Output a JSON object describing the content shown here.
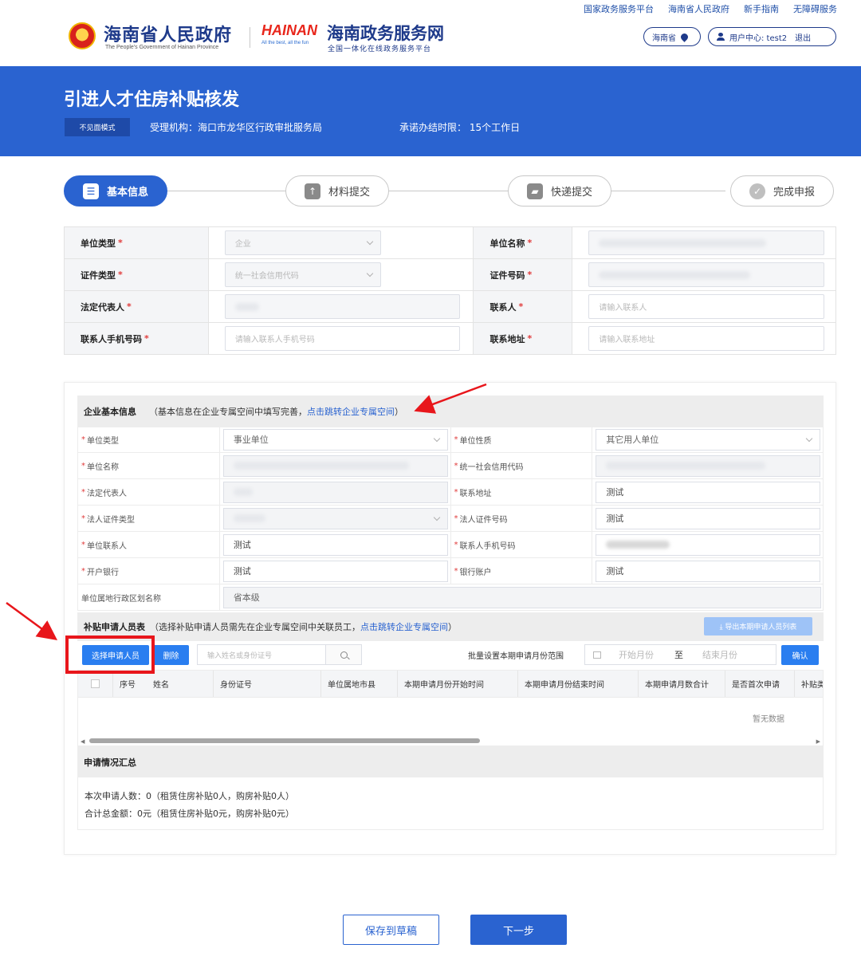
{
  "top_links": [
    "国家政务服务平台",
    "海南省人民政府",
    "新手指南",
    "无障碍服务"
  ],
  "header": {
    "gov_title": "海南省人民政府",
    "gov_subtitle": "The People's Government of Hainan Province",
    "hainan_logo": "HAINAN",
    "service_title": "海南政务服务网",
    "service_subtitle": "全国一体化在线政务服务平台",
    "region": "海南省",
    "user_center": "用户中心: test2",
    "logout": "退出"
  },
  "banner": {
    "title": "引进人才住房补贴核发",
    "mode_button": "不见面模式",
    "agency": "受理机构：海口市龙华区行政审批服务局",
    "deadline": "承诺办结时限： 15个工作日"
  },
  "steps": [
    {
      "label": "基本信息",
      "icon": "document-icon",
      "active": true
    },
    {
      "label": "材料提交",
      "icon": "upload-icon",
      "active": false
    },
    {
      "label": "快递提交",
      "icon": "truck-icon",
      "active": false
    },
    {
      "label": "完成申报",
      "icon": "check-circle-icon",
      "active": false
    }
  ],
  "basic_form": {
    "unit_type_label": "单位类型",
    "unit_type_value": "企业",
    "unit_name_label": "单位名称",
    "cert_type_label": "证件类型",
    "cert_type_value": "统一社会信用代码",
    "cert_no_label": "证件号码",
    "legal_rep_label": "法定代表人",
    "contact_label": "联系人",
    "contact_placeholder": "请输入联系人",
    "contact_phone_label": "联系人手机号码",
    "contact_phone_placeholder": "请输入联系人手机号码",
    "contact_addr_label": "联系地址",
    "contact_addr_placeholder": "请输入联系地址",
    "required_mark": "*"
  },
  "enterprise": {
    "section_title": "企业基本信息",
    "note_prefix": "（基本信息在企业专属空间中填写完善，",
    "note_link": "点击跳转企业专属空间",
    "note_suffix": "）",
    "star": "*",
    "rows": [
      {
        "l1": "单位类型",
        "v1": "事业单位",
        "l2": "单位性质",
        "v2": "其它用人单位"
      },
      {
        "l1": "单位名称",
        "v1": "",
        "l2": "统一社会信用代码",
        "v2": ""
      },
      {
        "l1": "法定代表人",
        "v1": "",
        "l2": "联系地址",
        "v2": "测试"
      },
      {
        "l1": "法人证件类型",
        "v1": "",
        "l2": "法人证件号码",
        "v2": "测试"
      },
      {
        "l1": "单位联系人",
        "v1": "测试",
        "l2": "联系人手机号码",
        "v2": ""
      },
      {
        "l1": "开户银行",
        "v1": "测试",
        "l2": "银行账户",
        "v2": "测试"
      }
    ],
    "region_label": "单位属地行政区划名称",
    "region_value": "省本级"
  },
  "applicants": {
    "section_title": "补贴申请人员表",
    "note_prefix": "（选择补贴申请人员需先在企业专属空间中关联员工，",
    "note_link": "点击跳转企业专属空间",
    "note_suffix": "）",
    "export_button": "⤓ 导出本期申请人员列表",
    "select_button": "选择申请人员",
    "delete_button": "删除",
    "search_placeholder": "输入姓名或身份证号",
    "batch_label": "批量设置本期申请月份范围",
    "start_month": "开始月份",
    "to": "至",
    "end_month": "结束月份",
    "confirm_button": "确认",
    "columns": [
      "序号",
      "姓名",
      "身份证号",
      "单位属地市县",
      "本期申请月份开始时间",
      "本期申请月份结束时间",
      "本期申请月数合计",
      "是否首次申请",
      "补贴类"
    ],
    "no_data": "暂无数据"
  },
  "summary": {
    "title": "申请情况汇总",
    "line1": "本次申请人数：0（租赁住房补贴0人，购房补贴0人）",
    "line2": "合计总金额：0元（租赁住房补贴0元，购房补贴0元）"
  },
  "footer": {
    "save_button": "保存到草稿",
    "next_button": "下一步"
  },
  "colors": {
    "primary": "#2a63d0",
    "annotation_red": "#e8161b"
  }
}
